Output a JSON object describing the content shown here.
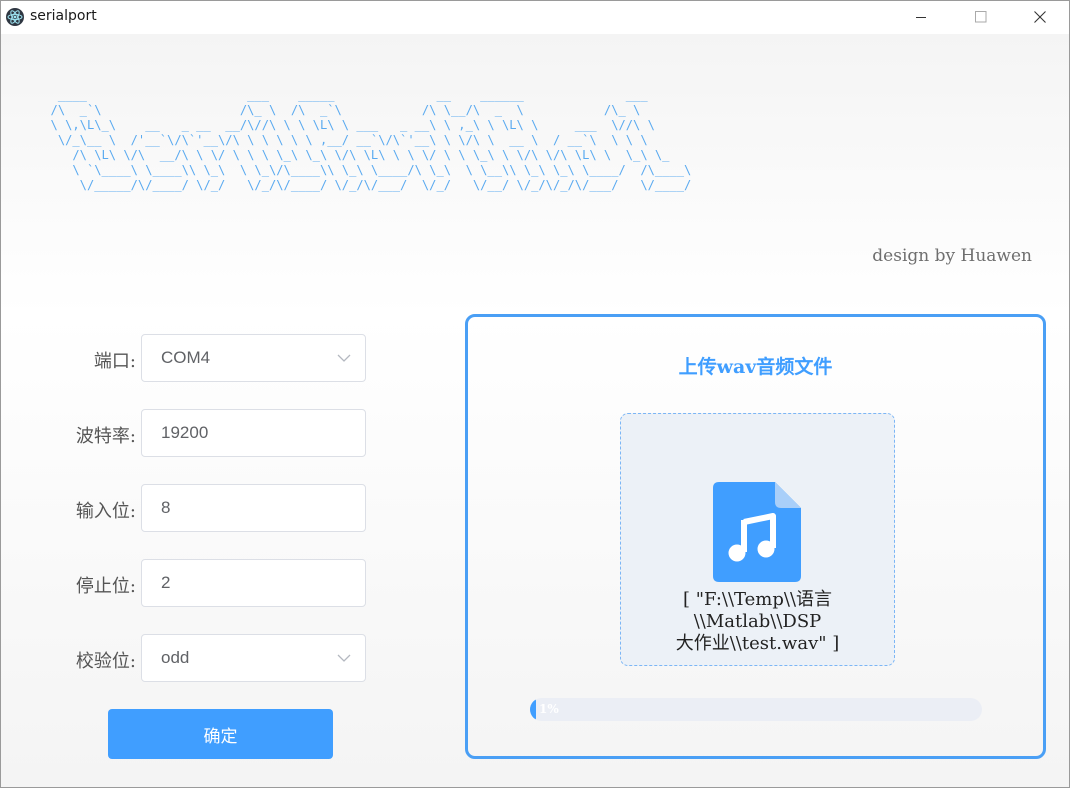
{
  "window": {
    "title": "serialport"
  },
  "banner": {
    "art": "   ____                      ___    _____              __    ______              ___\n  /\\  _`\\                   /\\_ \\  /\\  _`\\           /\\ \\__/\\  _  \\           /\\_ \\\n  \\ \\,\\L\\_\\    __   _ __  __/\\//\\ \\ \\ \\L\\ \\ ___   _ __\\ \\ ,_\\ \\ \\L\\ \\     ___  \\//\\ \\\n   \\/_\\__ \\  /'__`\\/\\`'__\\/\\ \\ \\ \\ \\ \\ ,__/ __`\\/\\`'__\\ \\ \\/\\ \\  __ \\  / __`\\  \\ \\ \\\n     /\\ \\L\\ \\/\\  __/\\ \\ \\/ \\ \\ \\ \\_\\ \\_\\ \\/\\ \\L\\ \\ \\ \\/ \\ \\ \\_\\ \\ \\/\\ \\/\\ \\L\\ \\  \\_\\ \\_\n     \\ `\\____\\ \\____\\\\ \\_\\  \\ \\_\\/\\____\\\\ \\_\\ \\____/\\ \\_\\  \\ \\__\\\\ \\_\\ \\_\\ \\____/  /\\____\\\n      \\/_____/\\/____/ \\/_/   \\/_/\\/____/ \\/_/\\/___/  \\/_/   \\/__/ \\/_/\\/_/\\/___/   \\/____/",
    "credit": "design by Huawen"
  },
  "form": {
    "port": {
      "label": "端口:",
      "value": "COM4"
    },
    "baud": {
      "label": "波特率:",
      "value": "19200"
    },
    "databits": {
      "label": "输入位:",
      "value": "8"
    },
    "stopbits": {
      "label": "停止位:",
      "value": "2"
    },
    "parity": {
      "label": "校验位:",
      "value": "odd"
    },
    "confirm_label": "确定"
  },
  "upload": {
    "title": "上传wav音频文件",
    "file_line1": "[ \"F:\\\\Temp\\\\语言\\\\Matlab\\\\DSP",
    "file_line2": "大作业\\\\test.wav\" ]",
    "progress_text": "1%",
    "progress_value": 0.01
  },
  "colors": {
    "accent": "#409eff",
    "banner": "#5aaaf0",
    "panel_border": "#4a9ff5"
  },
  "icons": {
    "app": "electron-icon",
    "file": "music-file-icon"
  }
}
